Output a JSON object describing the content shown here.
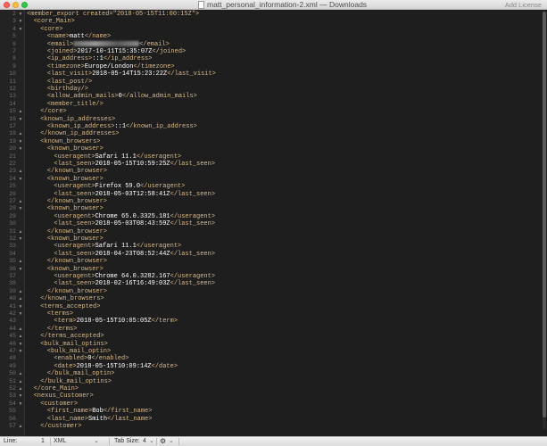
{
  "window": {
    "title": "matt_personal_information-2.xml — Downloads",
    "license_label": "Add License"
  },
  "editor": {
    "lines": [
      {
        "n": "2",
        "fold": "▼",
        "indent": 0,
        "tag": "<member_export created=\"2018-05-15T11:00:15Z\">"
      },
      {
        "n": "3",
        "fold": "▼",
        "indent": 1,
        "tag": "<core_Main>"
      },
      {
        "n": "4",
        "fold": "▼",
        "indent": 2,
        "tag": "<core>"
      },
      {
        "n": "5",
        "fold": "",
        "indent": 3,
        "tag": "<name>",
        "text": "matt",
        "close": "</name>"
      },
      {
        "n": "6",
        "fold": "",
        "indent": 3,
        "tag": "<email>",
        "blurred": true,
        "close": "</email>"
      },
      {
        "n": "7",
        "fold": "",
        "indent": 3,
        "tag": "<joined>",
        "text": "2017-10-11T15:35:07Z",
        "close": "</joined>"
      },
      {
        "n": "8",
        "fold": "",
        "indent": 3,
        "tag": "<ip_address>",
        "text": "::1",
        "close": "</ip_address>"
      },
      {
        "n": "9",
        "fold": "",
        "indent": 3,
        "tag": "<timezone>",
        "text": "Europe/London",
        "close": "</timezone>"
      },
      {
        "n": "10",
        "fold": "",
        "indent": 3,
        "tag": "<last_visit>",
        "text": "2018-05-14T15:23:22Z",
        "close": "</last_visit>"
      },
      {
        "n": "11",
        "fold": "",
        "indent": 3,
        "tag": "<last_post/>"
      },
      {
        "n": "12",
        "fold": "",
        "indent": 3,
        "tag": "<birthday/>"
      },
      {
        "n": "13",
        "fold": "",
        "indent": 3,
        "tag": "<allow_admin_mails>",
        "text": "0",
        "close": "</allow_admin_mails>"
      },
      {
        "n": "14",
        "fold": "",
        "indent": 3,
        "tag": "<member_title/>"
      },
      {
        "n": "15",
        "fold": "▲",
        "indent": 2,
        "tag": "</core>"
      },
      {
        "n": "16",
        "fold": "▼",
        "indent": 2,
        "tag": "<known_ip_addresses>"
      },
      {
        "n": "17",
        "fold": "",
        "indent": 3,
        "tag": "<known_ip_address>",
        "text": "::1",
        "close": "</known_ip_address>"
      },
      {
        "n": "18",
        "fold": "▲",
        "indent": 2,
        "tag": "</known_ip_addresses>"
      },
      {
        "n": "19",
        "fold": "▼",
        "indent": 2,
        "tag": "<known_browsers>"
      },
      {
        "n": "20",
        "fold": "▼",
        "indent": 3,
        "tag": "<known_browser>"
      },
      {
        "n": "21",
        "fold": "",
        "indent": 4,
        "tag": "<useragent>",
        "text": "Safari 11.1",
        "close": "</useragent>"
      },
      {
        "n": "22",
        "fold": "",
        "indent": 4,
        "tag": "<last_seen>",
        "text": "2018-05-15T10:59:25Z",
        "close": "</last_seen>"
      },
      {
        "n": "23",
        "fold": "▲",
        "indent": 3,
        "tag": "</known_browser>"
      },
      {
        "n": "24",
        "fold": "▼",
        "indent": 3,
        "tag": "<known_browser>"
      },
      {
        "n": "25",
        "fold": "",
        "indent": 4,
        "tag": "<useragent>",
        "text": "Firefox 59.0",
        "close": "</useragent>"
      },
      {
        "n": "26",
        "fold": "",
        "indent": 4,
        "tag": "<last_seen>",
        "text": "2018-05-03T12:58:41Z",
        "close": "</last_seen>"
      },
      {
        "n": "27",
        "fold": "▲",
        "indent": 3,
        "tag": "</known_browser>"
      },
      {
        "n": "28",
        "fold": "▼",
        "indent": 3,
        "tag": "<known_browser>"
      },
      {
        "n": "29",
        "fold": "",
        "indent": 4,
        "tag": "<useragent>",
        "text": "Chrome 65.0.3325.181",
        "close": "</useragent>"
      },
      {
        "n": "30",
        "fold": "",
        "indent": 4,
        "tag": "<last_seen>",
        "text": "2018-05-03T08:43:59Z",
        "close": "</last_seen>"
      },
      {
        "n": "31",
        "fold": "▲",
        "indent": 3,
        "tag": "</known_browser>"
      },
      {
        "n": "32",
        "fold": "▼",
        "indent": 3,
        "tag": "<known_browser>"
      },
      {
        "n": "33",
        "fold": "",
        "indent": 4,
        "tag": "<useragent>",
        "text": "Safari 11.1",
        "close": "</useragent>"
      },
      {
        "n": "34",
        "fold": "",
        "indent": 4,
        "tag": "<last_seen>",
        "text": "2018-04-23T08:52:44Z",
        "close": "</last_seen>"
      },
      {
        "n": "35",
        "fold": "▲",
        "indent": 3,
        "tag": "</known_browser>"
      },
      {
        "n": "36",
        "fold": "▼",
        "indent": 3,
        "tag": "<known_browser>"
      },
      {
        "n": "37",
        "fold": "",
        "indent": 4,
        "tag": "<useragent>",
        "text": "Chrome 64.0.3282.167",
        "close": "</useragent>"
      },
      {
        "n": "38",
        "fold": "",
        "indent": 4,
        "tag": "<last_seen>",
        "text": "2018-02-16T16:49:03Z",
        "close": "</last_seen>"
      },
      {
        "n": "39",
        "fold": "▲",
        "indent": 3,
        "tag": "</known_browser>"
      },
      {
        "n": "40",
        "fold": "▲",
        "indent": 2,
        "tag": "</known_browsers>"
      },
      {
        "n": "41",
        "fold": "▼",
        "indent": 2,
        "tag": "<terms_accepted>"
      },
      {
        "n": "42",
        "fold": "▼",
        "indent": 3,
        "tag": "<terms>"
      },
      {
        "n": "43",
        "fold": "",
        "indent": 4,
        "tag": "<term>",
        "text": "2018-05-15T10:05:05Z",
        "close": "</term>"
      },
      {
        "n": "44",
        "fold": "▲",
        "indent": 3,
        "tag": "</terms>"
      },
      {
        "n": "45",
        "fold": "▲",
        "indent": 2,
        "tag": "</terms_accepted>"
      },
      {
        "n": "46",
        "fold": "▼",
        "indent": 2,
        "tag": "<bulk_mail_optins>"
      },
      {
        "n": "47",
        "fold": "▼",
        "indent": 3,
        "tag": "<bulk_mail_optin>"
      },
      {
        "n": "48",
        "fold": "",
        "indent": 4,
        "tag": "<enabled>",
        "text": "0",
        "close": "</enabled>"
      },
      {
        "n": "49",
        "fold": "",
        "indent": 4,
        "tag": "<date>",
        "text": "2018-05-15T10:09:14Z",
        "close": "</date>"
      },
      {
        "n": "50",
        "fold": "▲",
        "indent": 3,
        "tag": "</bulk_mail_optin>"
      },
      {
        "n": "51",
        "fold": "▲",
        "indent": 2,
        "tag": "</bulk_mail_optins>"
      },
      {
        "n": "52",
        "fold": "▲",
        "indent": 1,
        "tag": "</core_Main>"
      },
      {
        "n": "53",
        "fold": "▼",
        "indent": 1,
        "tag": "<nexus_Customer>"
      },
      {
        "n": "54",
        "fold": "▼",
        "indent": 2,
        "tag": "<customer>"
      },
      {
        "n": "55",
        "fold": "",
        "indent": 3,
        "tag": "<first_name>",
        "text": "Bob",
        "close": "</first_name>"
      },
      {
        "n": "56",
        "fold": "",
        "indent": 3,
        "tag": "<last_name>",
        "text": "Smith",
        "close": "</last_name>"
      },
      {
        "n": "57",
        "fold": "▲",
        "indent": 2,
        "tag": "</customer>"
      }
    ]
  },
  "statusbar": {
    "line_label": "Line:",
    "line_value": "1",
    "language": "XML",
    "tab_size_label": "Tab Size:",
    "tab_size_value": "4",
    "gear": "⚙",
    "chevron": "⌄"
  }
}
